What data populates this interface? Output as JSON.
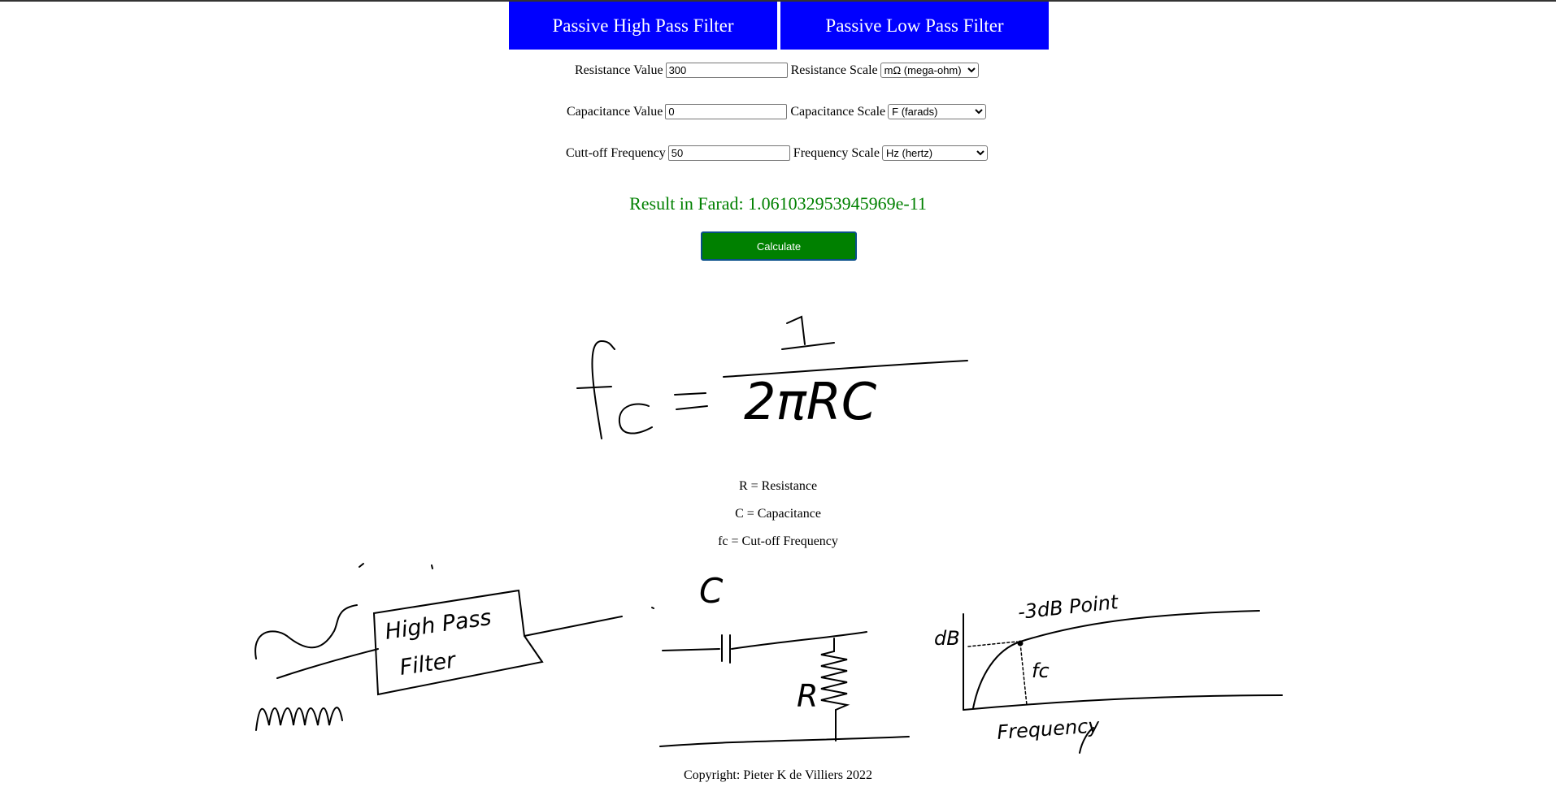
{
  "tabs": {
    "high_pass": "Passive High Pass Filter",
    "low_pass": "Passive Low Pass Filter"
  },
  "form": {
    "resistance_label": "Resistance Value",
    "resistance_value": "300",
    "resistance_scale_label": "Resistance Scale",
    "resistance_scale_selected": "mΩ (mega-ohm)",
    "capacitance_label": "Capacitance Value",
    "capacitance_value": "0",
    "capacitance_scale_label": "Capacitance Scale",
    "capacitance_scale_selected": "F (farads)",
    "frequency_label": "Cutt-off Frequency",
    "frequency_value": "50",
    "frequency_scale_label": "Frequency Scale",
    "frequency_scale_selected": "Hz (hertz)"
  },
  "result_text": "Result in Farad: 1.061032953945969e-11",
  "calculate_label": "Calculate",
  "formula": {
    "lhs": "fc =",
    "numerator": "1",
    "denominator": "2πRC"
  },
  "legend": {
    "r": "R = Resistance",
    "c": "C = Capacitance",
    "fc": "fc = Cut-off Frequency"
  },
  "sketches": {
    "filter_box_line1": "High Pass",
    "filter_box_line2": "Filter",
    "circuit_c": "C",
    "circuit_r": "R",
    "graph_y": "dB",
    "graph_point": "-3dB Point",
    "graph_fc": "fc",
    "graph_x": "Frequency"
  },
  "copyright": "Copyright: Pieter K de Villiers 2022",
  "colors": {
    "tab_bg": "#0000ff",
    "result": "#008000",
    "button_bg": "#008000"
  }
}
